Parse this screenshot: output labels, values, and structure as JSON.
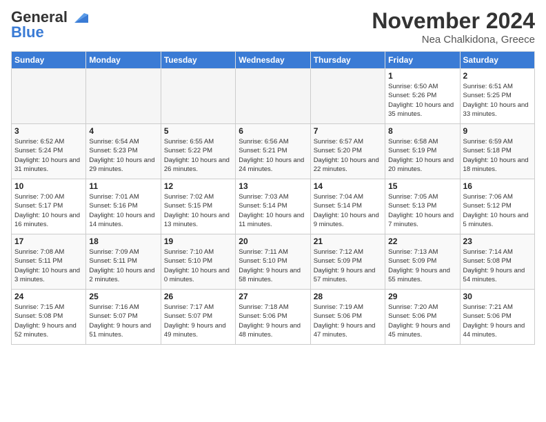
{
  "logo": {
    "line1": "General",
    "line2": "Blue"
  },
  "title": "November 2024",
  "location": "Nea Chalkidona, Greece",
  "days_of_week": [
    "Sunday",
    "Monday",
    "Tuesday",
    "Wednesday",
    "Thursday",
    "Friday",
    "Saturday"
  ],
  "weeks": [
    [
      {
        "num": "",
        "info": ""
      },
      {
        "num": "",
        "info": ""
      },
      {
        "num": "",
        "info": ""
      },
      {
        "num": "",
        "info": ""
      },
      {
        "num": "",
        "info": ""
      },
      {
        "num": "1",
        "info": "Sunrise: 6:50 AM\nSunset: 5:26 PM\nDaylight: 10 hours and 35 minutes."
      },
      {
        "num": "2",
        "info": "Sunrise: 6:51 AM\nSunset: 5:25 PM\nDaylight: 10 hours and 33 minutes."
      }
    ],
    [
      {
        "num": "3",
        "info": "Sunrise: 6:52 AM\nSunset: 5:24 PM\nDaylight: 10 hours and 31 minutes."
      },
      {
        "num": "4",
        "info": "Sunrise: 6:54 AM\nSunset: 5:23 PM\nDaylight: 10 hours and 29 minutes."
      },
      {
        "num": "5",
        "info": "Sunrise: 6:55 AM\nSunset: 5:22 PM\nDaylight: 10 hours and 26 minutes."
      },
      {
        "num": "6",
        "info": "Sunrise: 6:56 AM\nSunset: 5:21 PM\nDaylight: 10 hours and 24 minutes."
      },
      {
        "num": "7",
        "info": "Sunrise: 6:57 AM\nSunset: 5:20 PM\nDaylight: 10 hours and 22 minutes."
      },
      {
        "num": "8",
        "info": "Sunrise: 6:58 AM\nSunset: 5:19 PM\nDaylight: 10 hours and 20 minutes."
      },
      {
        "num": "9",
        "info": "Sunrise: 6:59 AM\nSunset: 5:18 PM\nDaylight: 10 hours and 18 minutes."
      }
    ],
    [
      {
        "num": "10",
        "info": "Sunrise: 7:00 AM\nSunset: 5:17 PM\nDaylight: 10 hours and 16 minutes."
      },
      {
        "num": "11",
        "info": "Sunrise: 7:01 AM\nSunset: 5:16 PM\nDaylight: 10 hours and 14 minutes."
      },
      {
        "num": "12",
        "info": "Sunrise: 7:02 AM\nSunset: 5:15 PM\nDaylight: 10 hours and 13 minutes."
      },
      {
        "num": "13",
        "info": "Sunrise: 7:03 AM\nSunset: 5:14 PM\nDaylight: 10 hours and 11 minutes."
      },
      {
        "num": "14",
        "info": "Sunrise: 7:04 AM\nSunset: 5:14 PM\nDaylight: 10 hours and 9 minutes."
      },
      {
        "num": "15",
        "info": "Sunrise: 7:05 AM\nSunset: 5:13 PM\nDaylight: 10 hours and 7 minutes."
      },
      {
        "num": "16",
        "info": "Sunrise: 7:06 AM\nSunset: 5:12 PM\nDaylight: 10 hours and 5 minutes."
      }
    ],
    [
      {
        "num": "17",
        "info": "Sunrise: 7:08 AM\nSunset: 5:11 PM\nDaylight: 10 hours and 3 minutes."
      },
      {
        "num": "18",
        "info": "Sunrise: 7:09 AM\nSunset: 5:11 PM\nDaylight: 10 hours and 2 minutes."
      },
      {
        "num": "19",
        "info": "Sunrise: 7:10 AM\nSunset: 5:10 PM\nDaylight: 10 hours and 0 minutes."
      },
      {
        "num": "20",
        "info": "Sunrise: 7:11 AM\nSunset: 5:10 PM\nDaylight: 9 hours and 58 minutes."
      },
      {
        "num": "21",
        "info": "Sunrise: 7:12 AM\nSunset: 5:09 PM\nDaylight: 9 hours and 57 minutes."
      },
      {
        "num": "22",
        "info": "Sunrise: 7:13 AM\nSunset: 5:09 PM\nDaylight: 9 hours and 55 minutes."
      },
      {
        "num": "23",
        "info": "Sunrise: 7:14 AM\nSunset: 5:08 PM\nDaylight: 9 hours and 54 minutes."
      }
    ],
    [
      {
        "num": "24",
        "info": "Sunrise: 7:15 AM\nSunset: 5:08 PM\nDaylight: 9 hours and 52 minutes."
      },
      {
        "num": "25",
        "info": "Sunrise: 7:16 AM\nSunset: 5:07 PM\nDaylight: 9 hours and 51 minutes."
      },
      {
        "num": "26",
        "info": "Sunrise: 7:17 AM\nSunset: 5:07 PM\nDaylight: 9 hours and 49 minutes."
      },
      {
        "num": "27",
        "info": "Sunrise: 7:18 AM\nSunset: 5:06 PM\nDaylight: 9 hours and 48 minutes."
      },
      {
        "num": "28",
        "info": "Sunrise: 7:19 AM\nSunset: 5:06 PM\nDaylight: 9 hours and 47 minutes."
      },
      {
        "num": "29",
        "info": "Sunrise: 7:20 AM\nSunset: 5:06 PM\nDaylight: 9 hours and 45 minutes."
      },
      {
        "num": "30",
        "info": "Sunrise: 7:21 AM\nSunset: 5:06 PM\nDaylight: 9 hours and 44 minutes."
      }
    ]
  ]
}
